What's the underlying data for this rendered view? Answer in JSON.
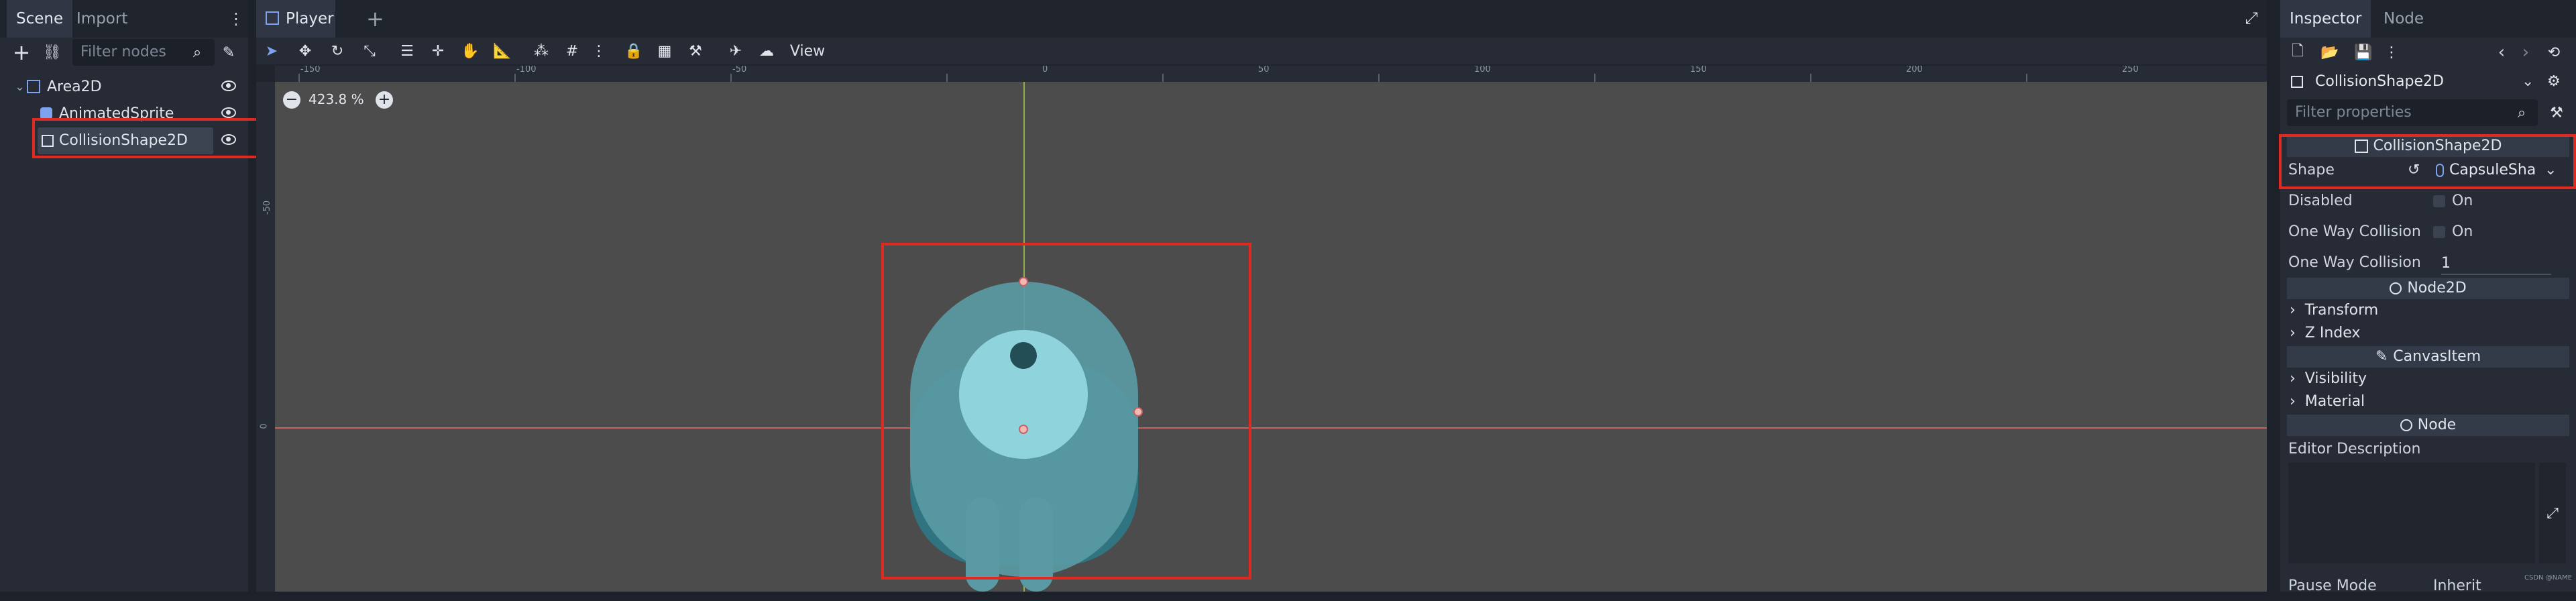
{
  "scene_dock": {
    "tabs": [
      "Scene",
      "Import"
    ],
    "filter_placeholder": "Filter nodes",
    "tree": [
      {
        "label": "Area2D",
        "icon": "area2d-icon"
      },
      {
        "label": "AnimatedSprite",
        "icon": "animated-sprite-icon"
      },
      {
        "label": "CollisionShape2D",
        "icon": "collision-shape-icon",
        "selected": true
      }
    ]
  },
  "editor": {
    "tab_label": "Player",
    "add_tab": "+",
    "view_menu": "View",
    "zoom": "423.8 %",
    "ruler_top": [
      "-150",
      "-100",
      "-50",
      "0",
      "50",
      "100",
      "150",
      "200",
      "250"
    ],
    "ruler_left": [
      "-50",
      "0"
    ]
  },
  "inspector": {
    "tabs": [
      "Inspector",
      "Node"
    ],
    "object_name": "CollisionShape2D",
    "filter_placeholder": "Filter properties",
    "sections": {
      "collision_header": "CollisionShape2D",
      "node2d_header": "Node2D",
      "canvas_item_header": "CanvasItem",
      "node_header": "Node"
    },
    "props": {
      "shape_label": "Shape",
      "shape_value": "CapsuleSha",
      "disabled_label": "Disabled",
      "disabled_value": "On",
      "one_way_label": "One Way Collision",
      "one_way_value": "On",
      "one_way_margin_label": "One Way Collision",
      "one_way_margin_value": "1",
      "transform": "Transform",
      "z_index": "Z Index",
      "visibility": "Visibility",
      "material": "Material",
      "editor_description": "Editor Description",
      "pause_mode_label": "Pause Mode",
      "pause_mode_value": "Inherit"
    },
    "watermark": "CSDN @NAME"
  },
  "colors": {
    "highlight": "#e0291f",
    "capsule": "#5a9aa4",
    "capsule_dark": "#2f7480",
    "sprite_face": "#8fd4dc",
    "axis_x": "#c86161",
    "axis_y": "#8fb04a"
  }
}
